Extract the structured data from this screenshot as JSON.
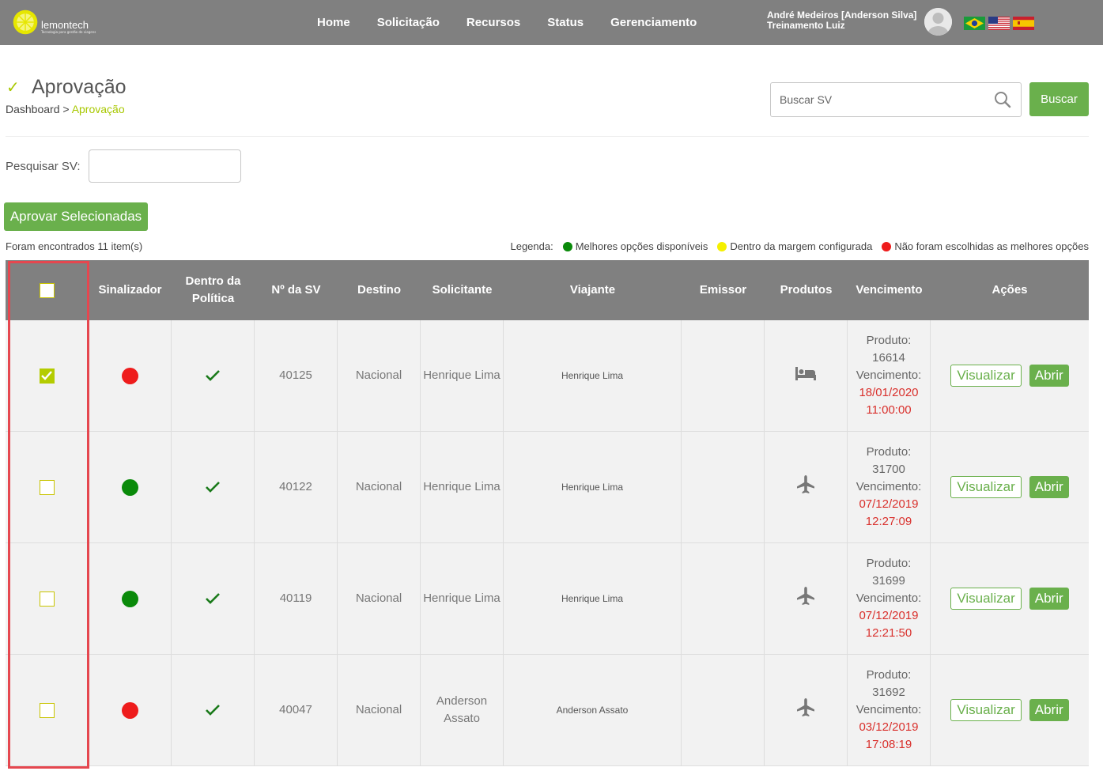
{
  "header": {
    "logo_text": "lemontech",
    "logo_tagline": "Tecnologia para gestão de viagens",
    "nav": [
      "Home",
      "Solicitação",
      "Recursos",
      "Status",
      "Gerenciamento"
    ],
    "user_name": "André Medeiros [Anderson Silva]",
    "user_org": "Treinamento Luiz"
  },
  "page": {
    "title": "Aprovação",
    "breadcrumb_root": "Dashboard",
    "breadcrumb_sep": " > ",
    "breadcrumb_current": "Aprovação",
    "search_placeholder": "Buscar SV",
    "search_button": "Buscar",
    "pesquisar_label": "Pesquisar SV:",
    "approve_button": "Aprovar Selecionadas",
    "found_text": "Foram encontrados 11 item(s)"
  },
  "legend": {
    "title": "Legenda:",
    "green": "Melhores opções disponíveis",
    "yellow": "Dentro da margem configurada",
    "red": "Não foram escolhidas as melhores opções",
    "colors": {
      "green": "#0a8a0a",
      "yellow": "#f5f000",
      "red": "#ee1c1c"
    }
  },
  "table": {
    "headers": [
      "Sinalizador",
      "Dentro da Política",
      "Nº da SV",
      "Destino",
      "Solicitante",
      "Viajante",
      "Emissor",
      "Produtos",
      "Vencimento",
      "Ações"
    ],
    "rows": [
      {
        "checked": true,
        "status": "red",
        "sv": "40125",
        "destino": "Nacional",
        "solicitante": "Henrique Lima",
        "viajante": "Henrique Lima",
        "emissor": "",
        "produto_icon": "bed-icon",
        "produto_label": "Produto:",
        "produto_num": "16614",
        "venc_label": "Vencimento:",
        "venc_date": "18/01/2020",
        "venc_time": "11:00:00",
        "btn_vis": "Visualizar",
        "btn_abrir": "Abrir"
      },
      {
        "checked": false,
        "status": "green",
        "sv": "40122",
        "destino": "Nacional",
        "solicitante": "Henrique Lima",
        "viajante": "Henrique Lima",
        "emissor": "",
        "produto_icon": "plane-icon",
        "produto_label": "Produto:",
        "produto_num": "31700",
        "venc_label": "Vencimento:",
        "venc_date": "07/12/2019",
        "venc_time": "12:27:09",
        "btn_vis": "Visualizar",
        "btn_abrir": "Abrir"
      },
      {
        "checked": false,
        "status": "green",
        "sv": "40119",
        "destino": "Nacional",
        "solicitante": "Henrique Lima",
        "viajante": "Henrique Lima",
        "emissor": "",
        "produto_icon": "plane-icon",
        "produto_label": "Produto:",
        "produto_num": "31699",
        "venc_label": "Vencimento:",
        "venc_date": "07/12/2019",
        "venc_time": "12:21:50",
        "btn_vis": "Visualizar",
        "btn_abrir": "Abrir"
      },
      {
        "checked": false,
        "status": "red",
        "sv": "40047",
        "destino": "Nacional",
        "solicitante": "Anderson Assato",
        "viajante": "Anderson Assato",
        "emissor": "",
        "produto_icon": "plane-icon",
        "produto_label": "Produto:",
        "produto_num": "31692",
        "venc_label": "Vencimento:",
        "venc_date": "03/12/2019",
        "venc_time": "17:08:19",
        "btn_vis": "Visualizar",
        "btn_abrir": "Abrir"
      }
    ]
  },
  "colors": {
    "accent": "#6ab04c",
    "lemon": "#a8c800",
    "topbar": "#808080",
    "highlight": "#e5474f",
    "deadline": "#d9302c"
  }
}
